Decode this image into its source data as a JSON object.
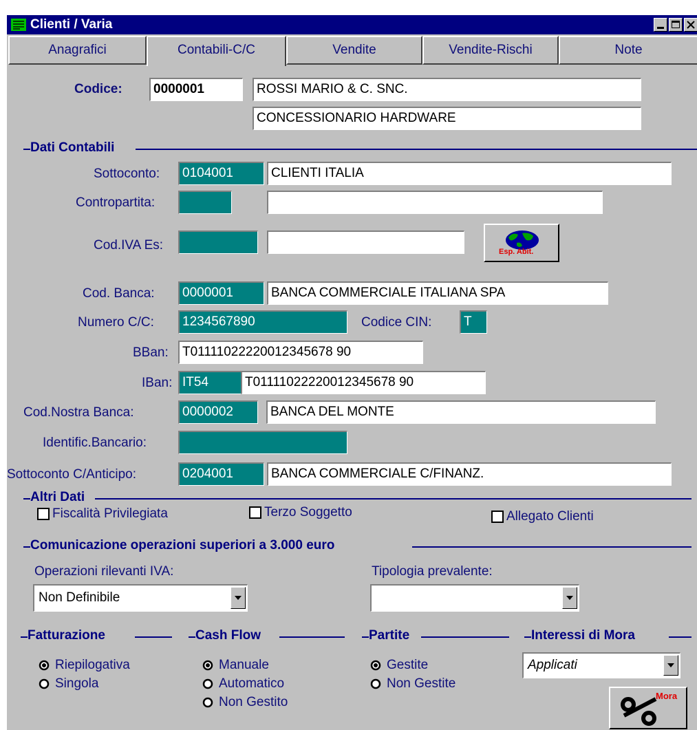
{
  "window": {
    "title": "Clienti / Varia"
  },
  "tabs": [
    {
      "label": "Anagrafici"
    },
    {
      "label": "Contabili-C/C"
    },
    {
      "label": "Vendite"
    },
    {
      "label": "Vendite-Rischi"
    },
    {
      "label": "Note"
    }
  ],
  "codice": {
    "label": "Codice:",
    "value": "0000001",
    "ragione_sociale": "ROSSI MARIO & C. SNC.",
    "descrizione": "CONCESSIONARIO HARDWARE"
  },
  "dati_contabili": {
    "title": "Dati Contabili",
    "sottoconto": {
      "label": "Sottoconto:",
      "code": "0104001",
      "desc": "CLIENTI  ITALIA"
    },
    "contropartita": {
      "label": "Contropartita:",
      "code": "",
      "desc": ""
    },
    "cod_iva_es": {
      "label": "Cod.IVA Es:",
      "code": "",
      "desc": "",
      "button_label": "Esp. Abit."
    },
    "cod_banca": {
      "label": "Cod. Banca:",
      "code": "0000001",
      "desc": "BANCA COMMERCIALE ITALIANA SPA"
    },
    "numero_cc": {
      "label": "Numero C/C:",
      "value": "1234567890"
    },
    "codice_cin": {
      "label": "Codice CIN:",
      "value": "T"
    },
    "bban": {
      "label": "BBan:",
      "value": "T01111022220012345678 90"
    },
    "iban": {
      "label": "IBan:",
      "prefix": "IT54",
      "value": "T01111022220012345678 90"
    },
    "cod_nostra_banca": {
      "label": "Cod.Nostra Banca:",
      "code": "0000002",
      "desc": "BANCA DEL MONTE"
    },
    "identific_bancario": {
      "label": "Identific.Bancario:",
      "value": ""
    },
    "sottoconto_anticipo": {
      "label": "Sottoconto C/Anticipo:",
      "code": "0204001",
      "desc": "BANCA COMMERCIALE C/FINANZ."
    }
  },
  "altri_dati": {
    "title": "Altri Dati",
    "fiscalita_privilegiata": {
      "label": "Fiscalità Privilegiata",
      "checked": false
    },
    "terzo_soggetto": {
      "label": "Terzo Soggetto",
      "checked": false
    },
    "allegato_clienti": {
      "label": "Allegato Clienti",
      "checked": false
    }
  },
  "comunicazione": {
    "title": "Comunicazione operazioni superiori a 3.000 euro",
    "operazioni_rilevanti": {
      "label": "Operazioni rilevanti IVA:",
      "value": "Non Definibile"
    },
    "tipologia_prevalente": {
      "label": "Tipologia prevalente:",
      "value": ""
    }
  },
  "fatturazione": {
    "title": "Fatturazione",
    "options": [
      {
        "label": "Riepilogativa",
        "selected": true
      },
      {
        "label": "Singola",
        "selected": false
      }
    ]
  },
  "cash_flow": {
    "title": "Cash Flow",
    "options": [
      {
        "label": "Manuale",
        "selected": true
      },
      {
        "label": "Automatico",
        "selected": false
      },
      {
        "label": "Non Gestito",
        "selected": false
      }
    ]
  },
  "partite": {
    "title": "Partite",
    "options": [
      {
        "label": "Gestite",
        "selected": true
      },
      {
        "label": "Non Gestite",
        "selected": false
      }
    ]
  },
  "interessi_mora": {
    "title": "Interessi di Mora",
    "value": "Applicati",
    "button_label": "Mora"
  },
  "colors": {
    "titlebar": "#000080",
    "teal": "#008080",
    "label": "#0f0f7a"
  }
}
